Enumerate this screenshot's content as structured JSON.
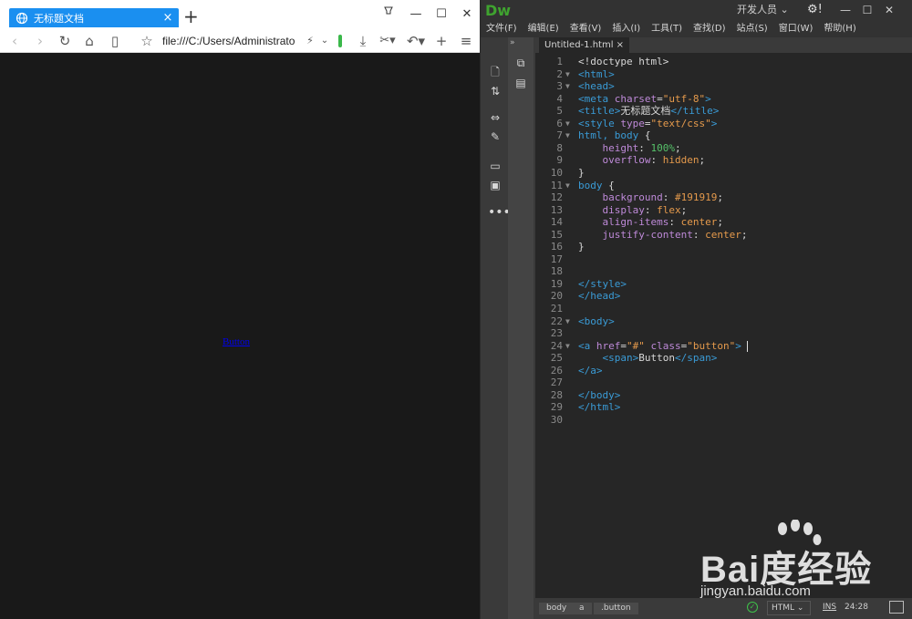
{
  "browser": {
    "tab_title": "无标题文档",
    "tab_close": "×",
    "new_tab": "+",
    "url": "file:///C:/Users/Administrator",
    "page_link": "Button",
    "window_controls": [
      "pin-icon",
      "minimize-icon",
      "maximize-icon",
      "close-icon"
    ],
    "toolbar_icons": [
      "back-icon",
      "forward-icon",
      "reload-icon",
      "home-icon",
      "reading-icon",
      "favorite-icon",
      "flash-icon",
      "dropdown-icon",
      "download-icon",
      "cut-icon",
      "undo-icon",
      "add-icon",
      "menu-icon"
    ]
  },
  "dreamweaver": {
    "logo": "Dw",
    "workspace": "开发人员",
    "menus": [
      "文件(F)",
      "编辑(E)",
      "查看(V)",
      "插入(I)",
      "工具(T)",
      "查找(D)",
      "站点(S)",
      "窗口(W)",
      "帮助(H)"
    ],
    "file_tab": "Untitled-1.html ×",
    "collapse_arrows": "»",
    "code_lines": [
      {
        "n": "1",
        "fold": "",
        "parts": [
          {
            "c": "plain",
            "t": "<!doctype html>"
          }
        ]
      },
      {
        "n": "2",
        "fold": "▼",
        "parts": [
          {
            "c": "tag",
            "t": "<html>"
          }
        ]
      },
      {
        "n": "3",
        "fold": "▼",
        "parts": [
          {
            "c": "tag",
            "t": "<head>"
          }
        ]
      },
      {
        "n": "4",
        "fold": "",
        "parts": [
          {
            "c": "tag",
            "t": "<meta "
          },
          {
            "c": "attr",
            "t": "charset"
          },
          {
            "c": "plain",
            "t": "="
          },
          {
            "c": "str",
            "t": "\"utf-8\""
          },
          {
            "c": "tag",
            "t": ">"
          }
        ]
      },
      {
        "n": "5",
        "fold": "",
        "parts": [
          {
            "c": "tag",
            "t": "<title>"
          },
          {
            "c": "plain",
            "t": "无标题文档"
          },
          {
            "c": "tag",
            "t": "</title>"
          }
        ]
      },
      {
        "n": "6",
        "fold": "▼",
        "parts": [
          {
            "c": "tag",
            "t": "<style "
          },
          {
            "c": "attr",
            "t": "type"
          },
          {
            "c": "plain",
            "t": "="
          },
          {
            "c": "str",
            "t": "\"text/css\""
          },
          {
            "c": "tag",
            "t": ">"
          }
        ]
      },
      {
        "n": "7",
        "fold": "▼",
        "parts": [
          {
            "c": "tag",
            "t": "html, body "
          },
          {
            "c": "plain",
            "t": "{"
          }
        ]
      },
      {
        "n": "8",
        "fold": "",
        "parts": [
          {
            "c": "plain",
            "t": "    "
          },
          {
            "c": "attr",
            "t": "height"
          },
          {
            "c": "plain",
            "t": ": "
          },
          {
            "c": "num",
            "t": "100%"
          },
          {
            "c": "plain",
            "t": ";"
          }
        ]
      },
      {
        "n": "9",
        "fold": "",
        "parts": [
          {
            "c": "plain",
            "t": "    "
          },
          {
            "c": "attr",
            "t": "overflow"
          },
          {
            "c": "plain",
            "t": ": "
          },
          {
            "c": "str",
            "t": "hidden"
          },
          {
            "c": "plain",
            "t": ";"
          }
        ]
      },
      {
        "n": "10",
        "fold": "",
        "parts": [
          {
            "c": "plain",
            "t": "}"
          }
        ]
      },
      {
        "n": "11",
        "fold": "▼",
        "parts": [
          {
            "c": "tag",
            "t": "body "
          },
          {
            "c": "plain",
            "t": "{"
          }
        ]
      },
      {
        "n": "12",
        "fold": "",
        "parts": [
          {
            "c": "plain",
            "t": "    "
          },
          {
            "c": "attr",
            "t": "background"
          },
          {
            "c": "plain",
            "t": ": "
          },
          {
            "c": "str",
            "t": "#191919"
          },
          {
            "c": "plain",
            "t": ";"
          }
        ]
      },
      {
        "n": "13",
        "fold": "",
        "parts": [
          {
            "c": "plain",
            "t": "    "
          },
          {
            "c": "attr",
            "t": "display"
          },
          {
            "c": "plain",
            "t": ": "
          },
          {
            "c": "str",
            "t": "flex"
          },
          {
            "c": "plain",
            "t": ";"
          }
        ]
      },
      {
        "n": "14",
        "fold": "",
        "parts": [
          {
            "c": "plain",
            "t": "    "
          },
          {
            "c": "attr",
            "t": "align-items"
          },
          {
            "c": "plain",
            "t": ": "
          },
          {
            "c": "str",
            "t": "center"
          },
          {
            "c": "plain",
            "t": ";"
          }
        ]
      },
      {
        "n": "15",
        "fold": "",
        "parts": [
          {
            "c": "plain",
            "t": "    "
          },
          {
            "c": "attr",
            "t": "justify-content"
          },
          {
            "c": "plain",
            "t": ": "
          },
          {
            "c": "str",
            "t": "center"
          },
          {
            "c": "plain",
            "t": ";"
          }
        ]
      },
      {
        "n": "16",
        "fold": "",
        "parts": [
          {
            "c": "plain",
            "t": "}"
          }
        ]
      },
      {
        "n": "17",
        "fold": "",
        "parts": []
      },
      {
        "n": "18",
        "fold": "",
        "parts": []
      },
      {
        "n": "19",
        "fold": "",
        "parts": [
          {
            "c": "tag",
            "t": "</style>"
          }
        ]
      },
      {
        "n": "20",
        "fold": "",
        "parts": [
          {
            "c": "tag",
            "t": "</head>"
          }
        ]
      },
      {
        "n": "21",
        "fold": "",
        "parts": []
      },
      {
        "n": "22",
        "fold": "▼",
        "parts": [
          {
            "c": "tag",
            "t": "<body>"
          }
        ]
      },
      {
        "n": "23",
        "fold": "",
        "parts": []
      },
      {
        "n": "24",
        "fold": "▼",
        "parts": [
          {
            "c": "tag",
            "t": "<a "
          },
          {
            "c": "attr",
            "t": "href"
          },
          {
            "c": "plain",
            "t": "="
          },
          {
            "c": "str",
            "t": "\"#\""
          },
          {
            "c": "plain",
            "t": " "
          },
          {
            "c": "attr",
            "t": "class"
          },
          {
            "c": "plain",
            "t": "="
          },
          {
            "c": "str",
            "t": "\"button\""
          },
          {
            "c": "tag",
            "t": ">"
          }
        ]
      },
      {
        "n": "25",
        "fold": "",
        "parts": [
          {
            "c": "plain",
            "t": "    "
          },
          {
            "c": "tag",
            "t": "<span>"
          },
          {
            "c": "plain",
            "t": "Button"
          },
          {
            "c": "tag",
            "t": "</span>"
          }
        ]
      },
      {
        "n": "26",
        "fold": "",
        "parts": [
          {
            "c": "tag",
            "t": "</a>"
          }
        ]
      },
      {
        "n": "27",
        "fold": "",
        "parts": []
      },
      {
        "n": "28",
        "fold": "",
        "parts": [
          {
            "c": "tag",
            "t": "</body>"
          }
        ]
      },
      {
        "n": "29",
        "fold": "",
        "parts": [
          {
            "c": "tag",
            "t": "</html>"
          }
        ]
      },
      {
        "n": "30",
        "fold": "",
        "parts": []
      }
    ],
    "status": {
      "crumbs": [
        "body",
        "a",
        ".button"
      ],
      "language": "HTML",
      "mode": "INS",
      "position": "24:28"
    },
    "left_icons": [
      "file-icon",
      "sort-icon",
      "insert-icon",
      "brush-icon",
      "comment-icon",
      "snippet-icon",
      "more-icon"
    ],
    "panel_icons": [
      "dom-icon",
      "code-view-icon"
    ]
  },
  "watermark": {
    "logo": "Bai度经验",
    "url": "jingyan.baidu.com"
  },
  "colors": {
    "browser_bg": "#191919",
    "tab_active": "#1a8ff0",
    "dw_bg": "#262626",
    "dw_logo": "#3fa32f"
  }
}
